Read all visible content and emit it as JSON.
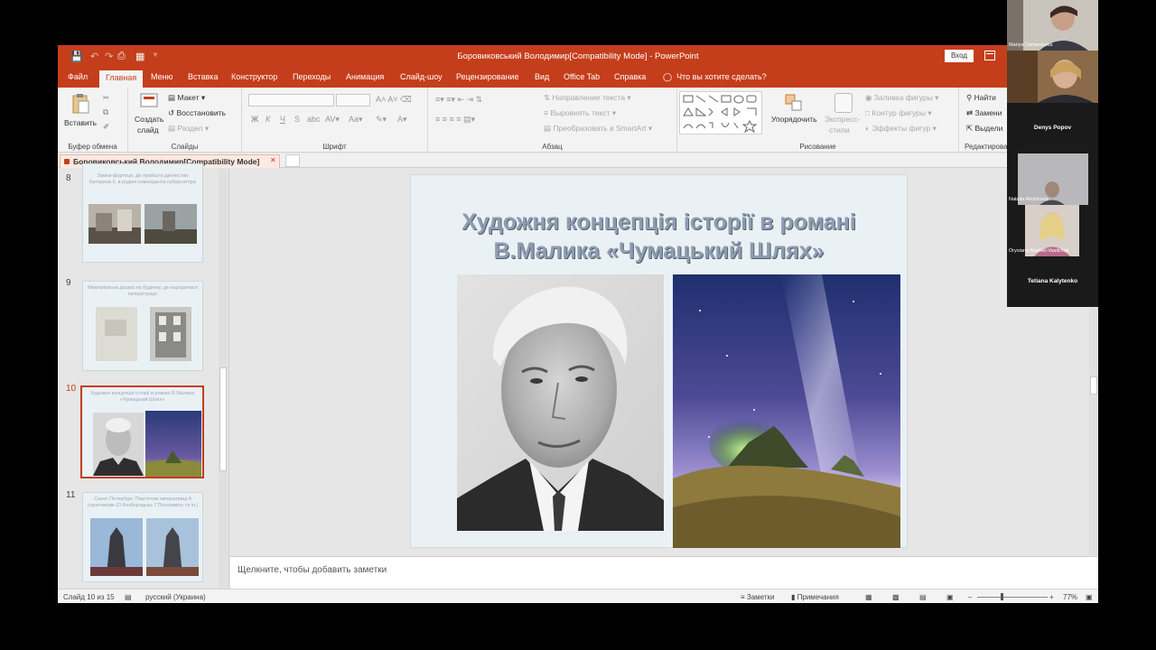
{
  "window": {
    "title": "Боровиковський Володимир[Compatibility Mode]  -  PowerPoint",
    "login_label": "Вход"
  },
  "ribbon_tabs": [
    "Файл",
    "Главная",
    "Меню",
    "Вставка",
    "Конструктор",
    "Переходы",
    "Анимация",
    "Слайд-шоу",
    "Рецензирование",
    "Вид",
    "Office Tab",
    "Справка"
  ],
  "active_tab_index": 1,
  "tell_me": "Что вы хотите сделать?",
  "groups": {
    "clipboard": {
      "label": "Буфер обмена",
      "paste": "Вставить"
    },
    "slides": {
      "label": "Слайды",
      "new_slide": "Создать",
      "new_slide2": "слайд",
      "layout": "Макет",
      "reset": "Восстановить",
      "section": "Раздел"
    },
    "font": {
      "label": "Шрифт"
    },
    "paragraph": {
      "label": "Абзац",
      "text_direction": "Направление текста",
      "align_text": "Выровнять текст",
      "smartart": "Преобразовать в SmartArt"
    },
    "drawing": {
      "label": "Рисование",
      "arrange": "Упорядочить",
      "quick_styles": "Экспресс-",
      "quick_styles2": "стили",
      "fill": "Заливка фигуры",
      "outline": "Контур фигуры",
      "effects": "Эффекты фигур"
    },
    "editing": {
      "label": "Редактирован",
      "find": "Найти",
      "replace": "Замени",
      "select": "Выдели"
    }
  },
  "doc_tab": "Боровиковський Володимир[Compatibility Mode]",
  "slides": [
    {
      "num": "8",
      "caption": "Замок-фортеця, де пройшло дитинство Катерини ІІ, в родині комендантa-губернатора"
    },
    {
      "num": "9",
      "caption": "Меморіальна дошка на будинку, де народилася імператриця"
    },
    {
      "num": "10",
      "caption": "Художня концепція історії в романі В.Малика «Чумацький Шлях»"
    },
    {
      "num": "11",
      "caption": "Санкт-Петербург. Пам'ятник імператриці й соратникам (О.Безбородьку, Г.Потьомкіну та ін.)"
    }
  ],
  "selected_slide": "10",
  "slide_title_line1": "Художня концепція історії в романі",
  "slide_title_line2": "В.Малика «Чумацький Шлях»",
  "notes_placeholder": "Щелкните, чтобы добавить заметки",
  "status": {
    "slide_counter": "Слайд 10 из 15",
    "language": "русский (Украина)",
    "notes": "Заметки",
    "comments": "Примечания",
    "zoom": "77%"
  },
  "participants": [
    {
      "name": "Mariya Domanivska"
    },
    {
      "name": ""
    },
    {
      "name": "Denys Popov"
    },
    {
      "name": "Natalia Aleshkova"
    },
    {
      "name": "Orysiana Nashkil-Vasilchuk"
    },
    {
      "name": "Tetiana Kalytenko"
    }
  ],
  "colors": {
    "accent": "#c43e1c",
    "title_text": "#8e9db1"
  }
}
